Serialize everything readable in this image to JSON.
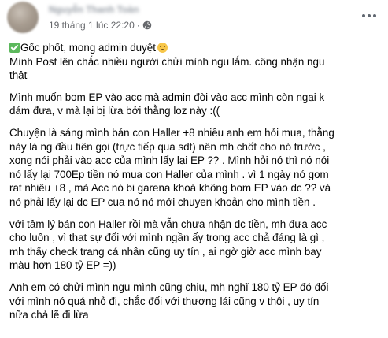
{
  "post": {
    "author_name": "Nguyễn Thanh Toàn",
    "timestamp": "19 tháng 1 lúc 22:20",
    "separator": "·",
    "privacy_icon": "globe-icon",
    "more_icon": "more-options-icon",
    "paragraphs": {
      "p1_text": "Gốc phốt, mong admin duyệt",
      "p1_line2": "Mình Post lên chắc nhiều người chửi mình ngu lắm. công nhận ngu\nthật",
      "p2": "Mình muốn bom EP vào acc mà admin đòi vào acc mình còn ngại k\ndám đưa, v mà lại bị lừa bởi thằng loz này :((",
      "p3": "Chuyện là sáng mình bán con Haller +8 nhiều anh em hỏi mua, thằng\nnày là ng đầu tiên gọi (trực tiếp qua sdt) nên mh chốt cho nó trước ,\nxong nói phải vào acc của mình lấy lại EP ?? . Mình hỏi nó thì nó nói\nnó lấy lại 700Ep tiền nó mua con Haller của mình . vì 1 ngày nó gom\nrat nhiêu +8 , mà Acc nó bi garena khoá không bom EP vào dc ?? và\nnó phải lấy lại dc EP cua nó nó mới chuyen khoản cho mình tiền .",
      "p4": "với tâm lý bán con Haller rồi mà vẫn chưa nhận dc tiền, mh đưa acc\ncho luôn , vì that sự đối với mình ngần ấy trong acc chả đáng là gì ,\nmh thấy check trang cá nhân cũng uy tín , ai ngờ giờ acc mình bay\nmàu hơn 180 tỷ EP =))",
      "p5": "Anh em có chửi mình ngu mình cũng chịu, mh nghĩ 180 tỷ EP đó đối\nvới mình nó quá nhỏ đi, chắc đối với thương lái cũng v thôi , uy tín\nnữa chả lẽ đi lừa"
    }
  }
}
